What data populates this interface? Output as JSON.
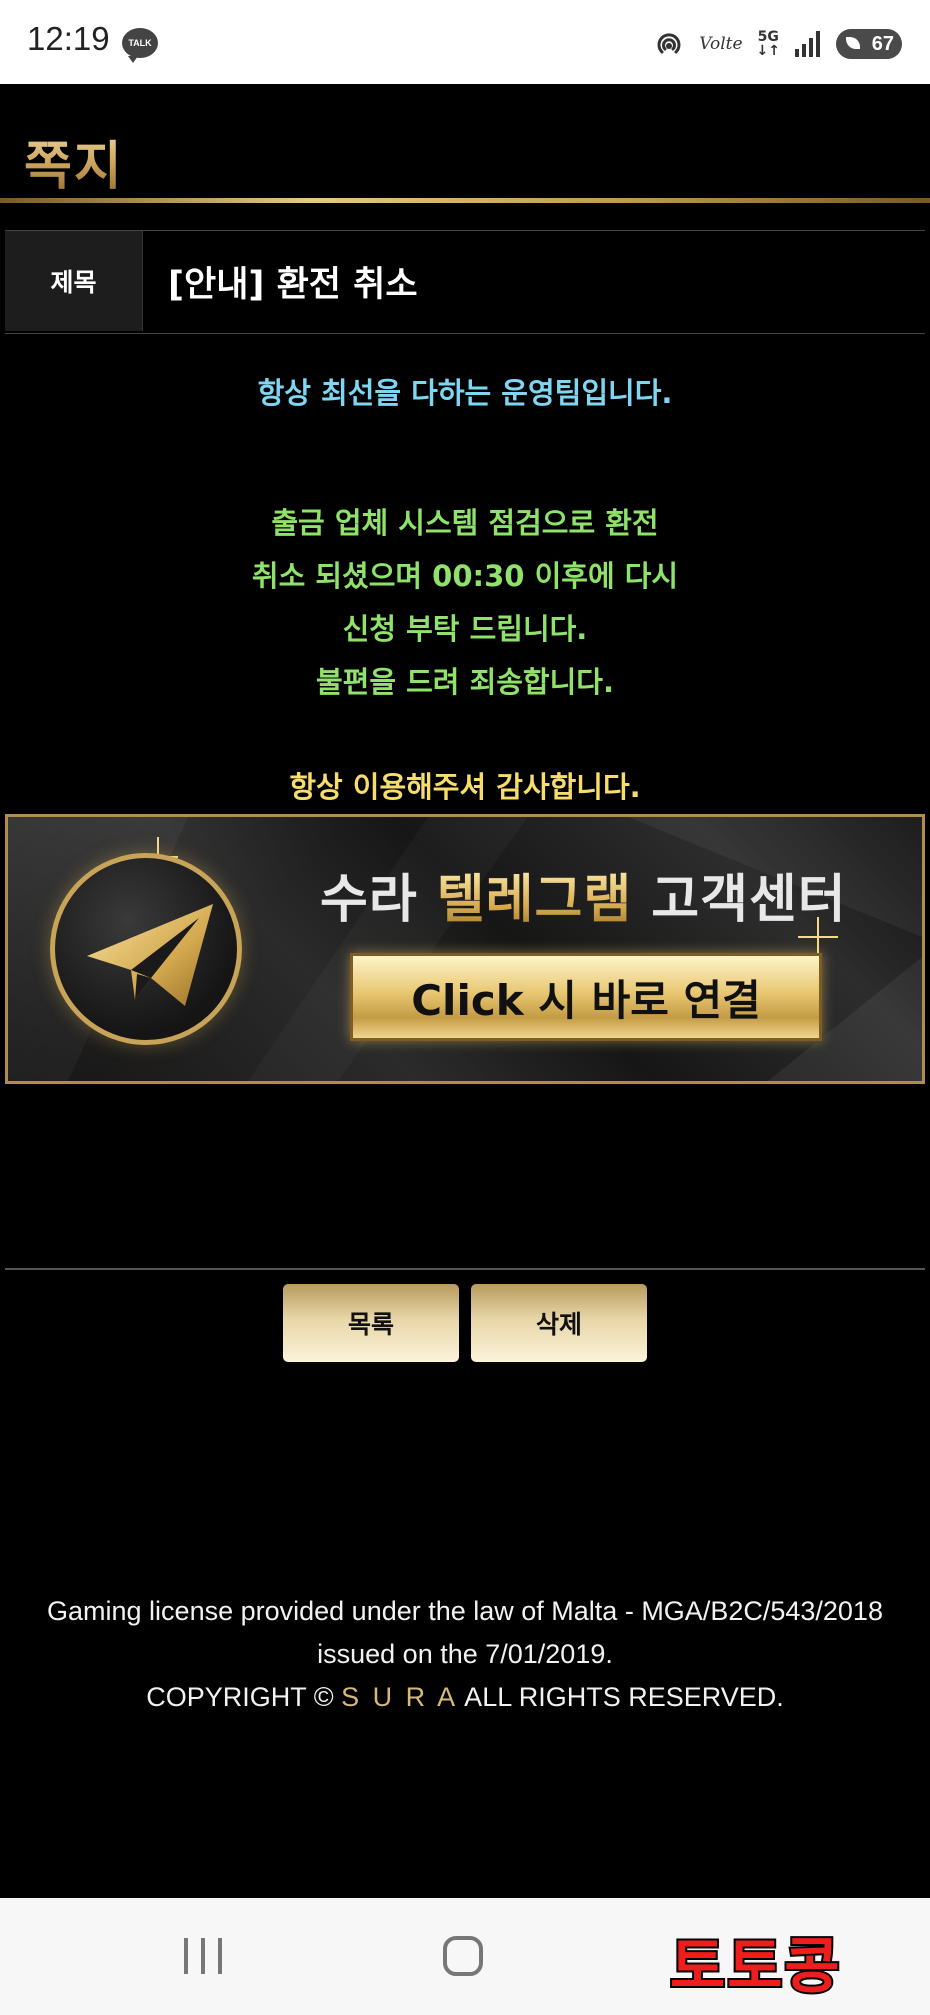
{
  "status_bar": {
    "time": "12:19",
    "talk_badge": "TALK",
    "volte": "Volte",
    "network": "5G",
    "battery": "67"
  },
  "header": {
    "title": "쪽지"
  },
  "subject": {
    "label": "제목",
    "value": "[안내] 환전 취소"
  },
  "message": {
    "greeting": "항상 최선을 다하는 운영팀입니다.",
    "body_lines": [
      "출금 업체 시스템 점검으로 환전",
      "취소 되셨으며 00:30 이후에 다시",
      "신청 부탁 드립니다.",
      "불편을 드려 죄송합니다."
    ],
    "closing": "항상 이용해주셔 감사합니다.",
    "colors": {
      "greeting": "#7fd6f2",
      "body": "#8fe26a",
      "closing": "#f7dd6b"
    }
  },
  "banner": {
    "title_part1": "수라 ",
    "title_part2": "텔레그램",
    "title_part3": " 고객센터",
    "button_label": "Click 시 바로 연결",
    "icon": "telegram-plane-icon"
  },
  "buttons": {
    "list_label": "목록",
    "delete_label": "삭제"
  },
  "footer": {
    "license_line1": "Gaming license provided under the law of Malta - MGA/B2C/543/2018",
    "license_line2": "issued on the 7/01/2019.",
    "copyright_prefix": "COPYRIGHT © ",
    "brand": "S U R A",
    "copyright_suffix": " ALL RIGHTS RESERVED."
  },
  "nav_bar": {
    "watermark": "토토콩"
  },
  "theme": {
    "gold": "#c9a258",
    "background": "#000000"
  }
}
